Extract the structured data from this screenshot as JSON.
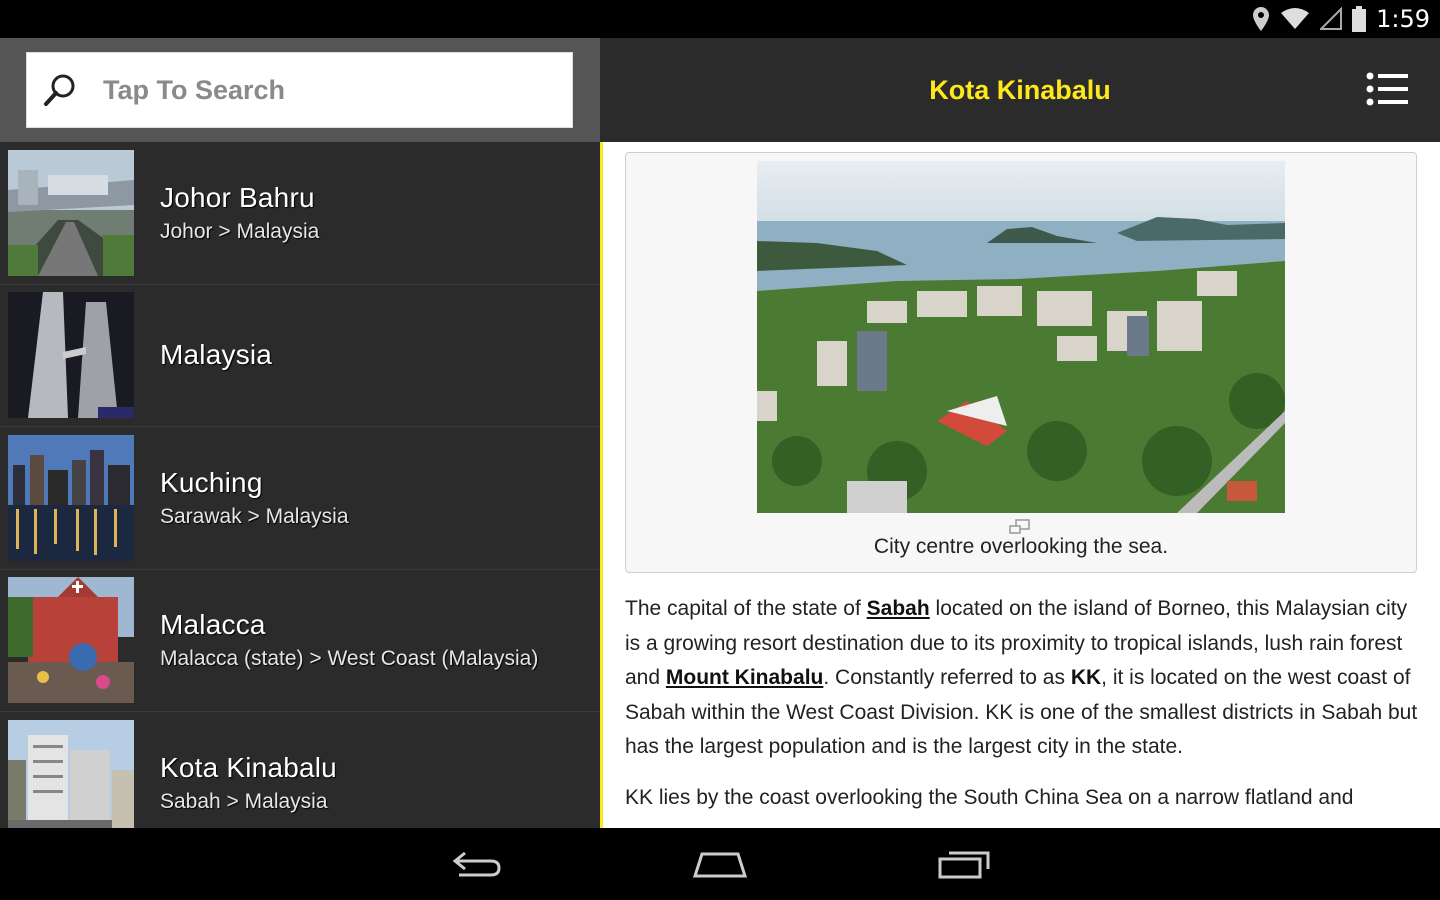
{
  "status_bar": {
    "time": "1:59",
    "icons": [
      "location-icon",
      "wifi-icon",
      "signal-icon",
      "battery-icon"
    ]
  },
  "search": {
    "placeholder": "Tap To Search"
  },
  "list": {
    "items": [
      {
        "title": "Johor Bahru",
        "subtitle": "Johor > Malaysia"
      },
      {
        "title": "Malaysia",
        "subtitle": ""
      },
      {
        "title": "Kuching",
        "subtitle": "Sarawak > Malaysia"
      },
      {
        "title": "Malacca",
        "subtitle": "Malacca (state) > West Coast (Malaysia)"
      },
      {
        "title": "Kota Kinabalu",
        "subtitle": "Sabah > Malaysia"
      }
    ]
  },
  "header": {
    "title": "Kota Kinabalu"
  },
  "figure": {
    "caption": "City centre overlooking the sea."
  },
  "article": {
    "p1_before_sabah": "The capital of the state of ",
    "link_sabah": "Sabah",
    "p1_after_sabah": " located on the island of Borneo, this Malaysian city is a growing resort destination due to its proximity to tropical islands, lush rain forest and ",
    "link_mount_kinabalu": "Mount Kinabalu",
    "p1_after_mount": ". Constantly referred to as ",
    "kk_bold": "KK",
    "p1_end": ", it is located on the west coast of Sabah within the West Coast Division. KK is one of the smallest districts in Sabah but has the largest population and is the largest city in the state.",
    "p2": "KK lies by the coast overlooking the South China Sea on a narrow flatland and"
  },
  "colors": {
    "accent": "#ffe81a",
    "panel": "#2b2b2b",
    "search_area": "#555555"
  }
}
